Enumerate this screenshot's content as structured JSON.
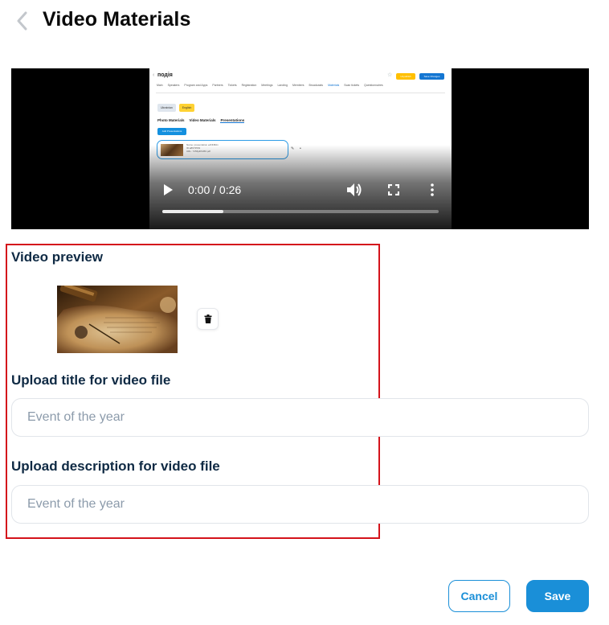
{
  "header": {
    "back_icon": "chevron-left-icon",
    "title": "Video Materials"
  },
  "video_player": {
    "time_display": "0:00 / 0:26",
    "progress": 0.22,
    "icons": [
      "play-icon",
      "volume-icon",
      "fullscreen-icon",
      "more-vert-icon"
    ],
    "frame_content": {
      "page_title": "подія",
      "nav_items": [
        "Main",
        "Speakers",
        "Program and Apps",
        "Partners",
        "Tickets",
        "Registration",
        "Meetings",
        "Landing",
        "Members",
        "Broadcasts",
        "Materials",
        "Scan tickets",
        "Questionnaires"
      ],
      "active_nav": "Materials",
      "top_buttons": [
        "Unpublish",
        "Save Changes"
      ],
      "languages": [
        "Ukrainian",
        "English"
      ],
      "active_language": "English",
      "tabs": [
        "Photo Materials",
        "Video Materials",
        "Presentations"
      ],
      "active_tab": "Presentations",
      "add_button": "Add Presentations",
      "card_lines": [
        "Name: presentation edNN8dn",
        "ID:a8973563",
        "URL: 7256jdb5d56.pdf"
      ]
    }
  },
  "form": {
    "video_preview_label": "Video preview",
    "delete_icon": "trash-icon",
    "title_label": "Upload title for video file",
    "title_placeholder": "Event of the year",
    "title_value": "",
    "description_label": "Upload description for video file",
    "description_placeholder": "Event of the year",
    "description_value": ""
  },
  "actions": {
    "cancel_label": "Cancel",
    "save_label": "Save"
  },
  "colors": {
    "accent": "#1a8fd8",
    "highlight": "#d4131b",
    "heading": "#0f2a44"
  }
}
